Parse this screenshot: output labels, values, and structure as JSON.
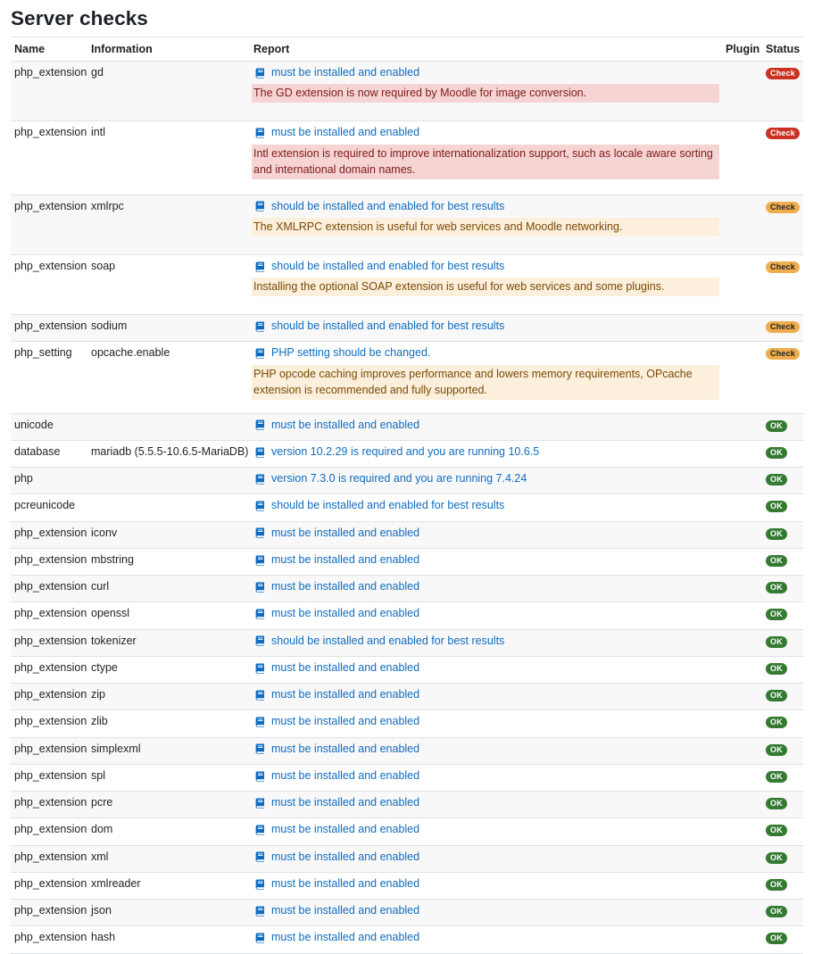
{
  "page": {
    "title": "Server checks"
  },
  "table": {
    "headers": {
      "name": "Name",
      "information": "Information",
      "report": "Report",
      "plugin": "Plugin",
      "status": "Status"
    },
    "rows": [
      {
        "name": "php_extension",
        "info": "gd",
        "report": "must be installed and enabled",
        "message": "The GD extension is now required by Moodle for image conversion.",
        "message_level": "error",
        "status": "Check",
        "status_level": "err"
      },
      {
        "name": "php_extension",
        "info": "intl",
        "report": "must be installed and enabled",
        "message": "Intl extension is required to improve internationalization support, such as locale aware sorting and international domain names.",
        "message_level": "error",
        "status": "Check",
        "status_level": "err"
      },
      {
        "name": "php_extension",
        "info": "xmlrpc",
        "report": "should be installed and enabled for best results",
        "message": "The XMLRPC extension is useful for web services and Moodle networking.",
        "message_level": "warning",
        "status": "Check",
        "status_level": "warn"
      },
      {
        "name": "php_extension",
        "info": "soap",
        "report": "should be installed and enabled for best results",
        "message": "Installing the optional SOAP extension is useful for web services and some plugins.",
        "message_level": "warning",
        "status": "Check",
        "status_level": "warn"
      },
      {
        "name": "php_extension",
        "info": "sodium",
        "report": "should be installed and enabled for best results",
        "message": "",
        "message_level": "",
        "status": "Check",
        "status_level": "warn"
      },
      {
        "name": "php_setting",
        "info": "opcache.enable",
        "report": "PHP setting should be changed.",
        "message": "PHP opcode caching improves performance and lowers memory requirements, OPcache extension is recommended and fully supported.",
        "message_level": "warning",
        "status": "Check",
        "status_level": "warn"
      },
      {
        "name": "unicode",
        "info": "",
        "report": "must be installed and enabled",
        "message": "",
        "message_level": "",
        "status": "OK",
        "status_level": "ok"
      },
      {
        "name": "database",
        "info": "mariadb (5.5.5-10.6.5-MariaDB)",
        "report": "version 10.2.29 is required and you are running 10.6.5",
        "message": "",
        "message_level": "",
        "status": "OK",
        "status_level": "ok"
      },
      {
        "name": "php",
        "info": "",
        "report": "version 7.3.0 is required and you are running 7.4.24",
        "message": "",
        "message_level": "",
        "status": "OK",
        "status_level": "ok"
      },
      {
        "name": "pcreunicode",
        "info": "",
        "report": "should be installed and enabled for best results",
        "message": "",
        "message_level": "",
        "status": "OK",
        "status_level": "ok"
      },
      {
        "name": "php_extension",
        "info": "iconv",
        "report": "must be installed and enabled",
        "message": "",
        "message_level": "",
        "status": "OK",
        "status_level": "ok"
      },
      {
        "name": "php_extension",
        "info": "mbstring",
        "report": "must be installed and enabled",
        "message": "",
        "message_level": "",
        "status": "OK",
        "status_level": "ok"
      },
      {
        "name": "php_extension",
        "info": "curl",
        "report": "must be installed and enabled",
        "message": "",
        "message_level": "",
        "status": "OK",
        "status_level": "ok"
      },
      {
        "name": "php_extension",
        "info": "openssl",
        "report": "must be installed and enabled",
        "message": "",
        "message_level": "",
        "status": "OK",
        "status_level": "ok"
      },
      {
        "name": "php_extension",
        "info": "tokenizer",
        "report": "should be installed and enabled for best results",
        "message": "",
        "message_level": "",
        "status": "OK",
        "status_level": "ok"
      },
      {
        "name": "php_extension",
        "info": "ctype",
        "report": "must be installed and enabled",
        "message": "",
        "message_level": "",
        "status": "OK",
        "status_level": "ok"
      },
      {
        "name": "php_extension",
        "info": "zip",
        "report": "must be installed and enabled",
        "message": "",
        "message_level": "",
        "status": "OK",
        "status_level": "ok"
      },
      {
        "name": "php_extension",
        "info": "zlib",
        "report": "must be installed and enabled",
        "message": "",
        "message_level": "",
        "status": "OK",
        "status_level": "ok"
      },
      {
        "name": "php_extension",
        "info": "simplexml",
        "report": "must be installed and enabled",
        "message": "",
        "message_level": "",
        "status": "OK",
        "status_level": "ok"
      },
      {
        "name": "php_extension",
        "info": "spl",
        "report": "must be installed and enabled",
        "message": "",
        "message_level": "",
        "status": "OK",
        "status_level": "ok"
      },
      {
        "name": "php_extension",
        "info": "pcre",
        "report": "must be installed and enabled",
        "message": "",
        "message_level": "",
        "status": "OK",
        "status_level": "ok"
      },
      {
        "name": "php_extension",
        "info": "dom",
        "report": "must be installed and enabled",
        "message": "",
        "message_level": "",
        "status": "OK",
        "status_level": "ok"
      },
      {
        "name": "php_extension",
        "info": "xml",
        "report": "must be installed and enabled",
        "message": "",
        "message_level": "",
        "status": "OK",
        "status_level": "ok"
      },
      {
        "name": "php_extension",
        "info": "xmlreader",
        "report": "must be installed and enabled",
        "message": "",
        "message_level": "",
        "status": "OK",
        "status_level": "ok"
      },
      {
        "name": "php_extension",
        "info": "json",
        "report": "must be installed and enabled",
        "message": "",
        "message_level": "",
        "status": "OK",
        "status_level": "ok"
      },
      {
        "name": "php_extension",
        "info": "hash",
        "report": "must be installed and enabled",
        "message": "",
        "message_level": "",
        "status": "OK",
        "status_level": "ok"
      }
    ]
  },
  "icons": {
    "report_link": "book-icon"
  },
  "colors": {
    "link": "#0f6cbf",
    "ok_badge": "#357a32",
    "error_badge": "#ca3120",
    "warning_badge": "#f0ad4e",
    "error_bg": "#f6d4d4",
    "warning_bg": "#fcefdc"
  }
}
